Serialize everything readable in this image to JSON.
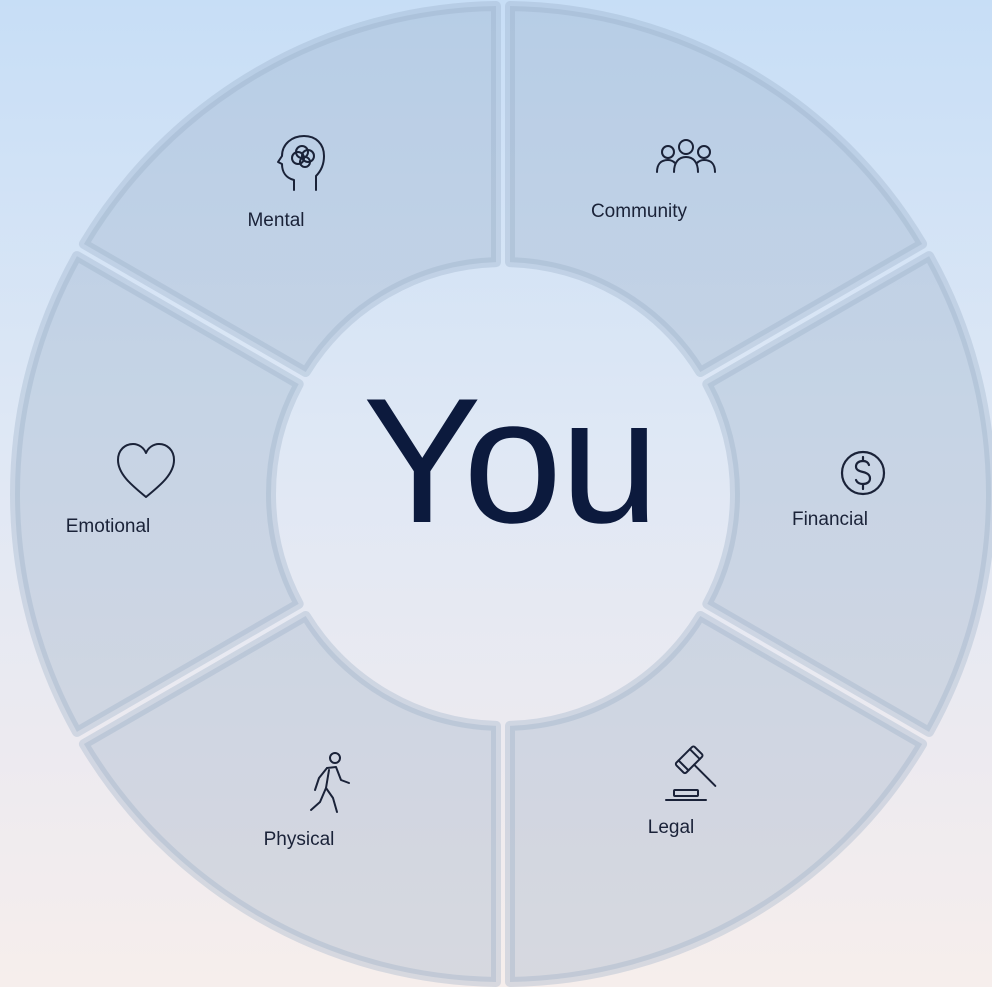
{
  "center": {
    "label": "You"
  },
  "segments": [
    {
      "id": "mental",
      "label": "Mental",
      "icon": "head-brain-icon"
    },
    {
      "id": "community",
      "label": "Community",
      "icon": "people-group-icon"
    },
    {
      "id": "financial",
      "label": "Financial",
      "icon": "dollar-coin-icon"
    },
    {
      "id": "legal",
      "label": "Legal",
      "icon": "gavel-icon"
    },
    {
      "id": "physical",
      "label": "Physical",
      "icon": "walking-person-icon"
    },
    {
      "id": "emotional",
      "label": "Emotional",
      "icon": "heart-icon"
    }
  ],
  "colors": {
    "segment_fill": "#96aac3",
    "text": "#1a2238",
    "center_text": "#0c1a3d",
    "background_top": "#c7def6",
    "background_bottom": "#f6eeec"
  }
}
